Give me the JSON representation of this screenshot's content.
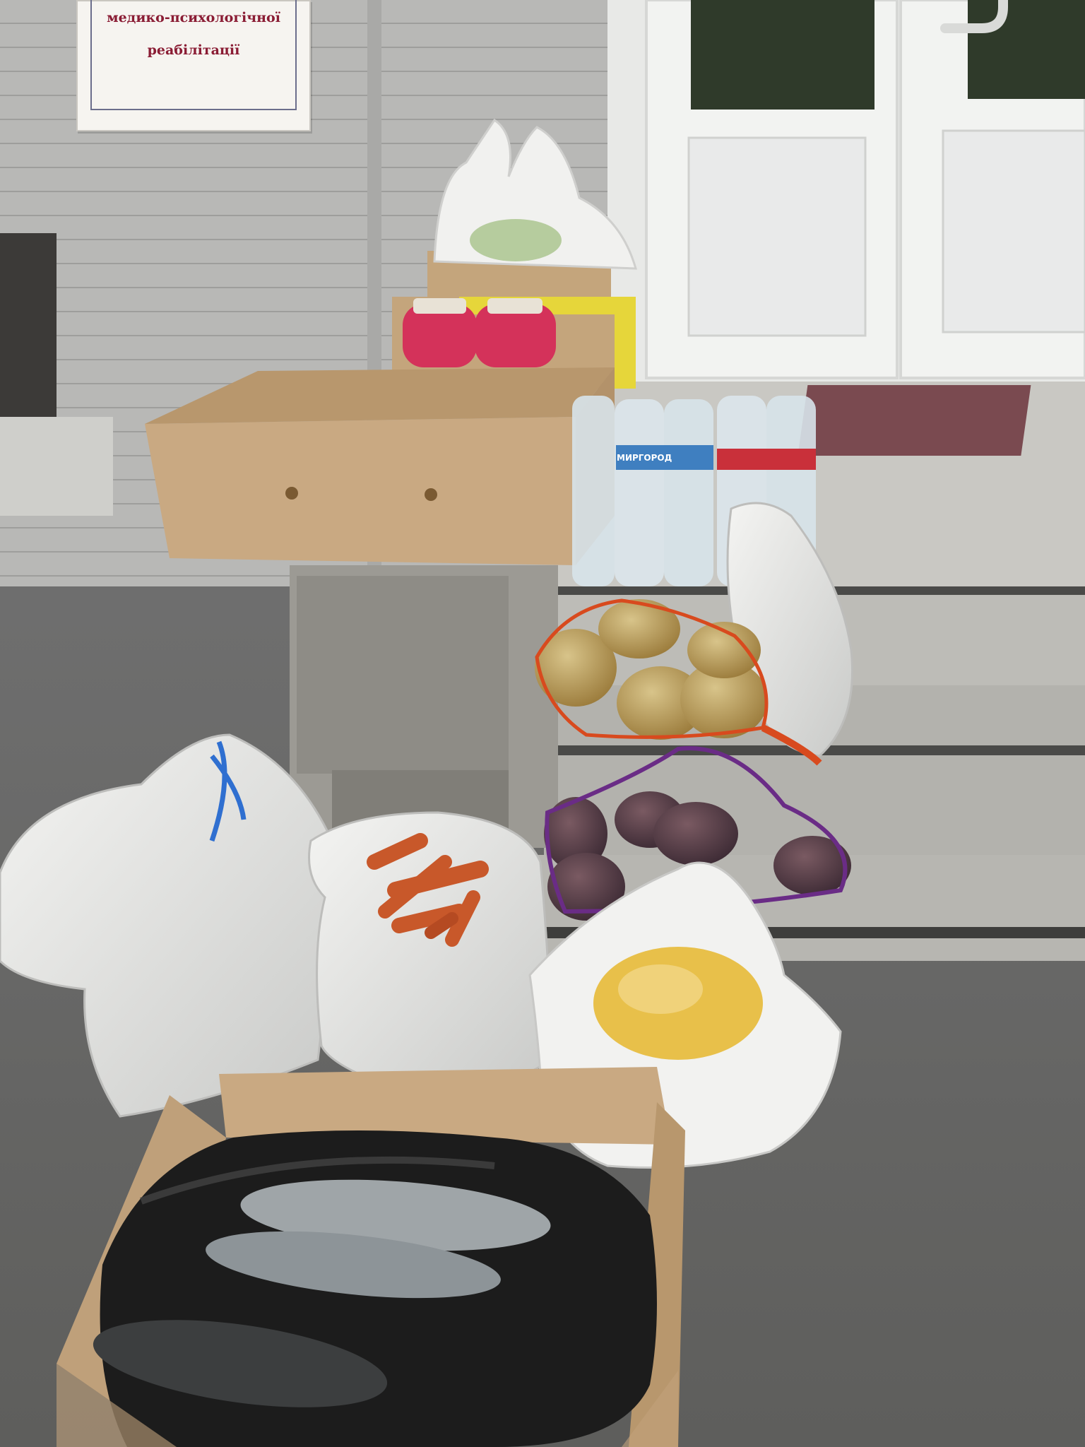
{
  "sign": {
    "line1": "медико-психологічної",
    "line2": "реабілітації"
  },
  "bottle_label": "МИРГОРОД",
  "colors": {
    "sign_text": "#8a1c34",
    "wall": "#b5b5b3",
    "door": "#f2f3f1",
    "asphalt": "#6a6a68",
    "cardboard": "#c9a982",
    "pickled_jar": "#d4325a",
    "onion_net": "#d84a1e",
    "potato_net": "#6a2c86",
    "carrot": "#c8582a"
  }
}
